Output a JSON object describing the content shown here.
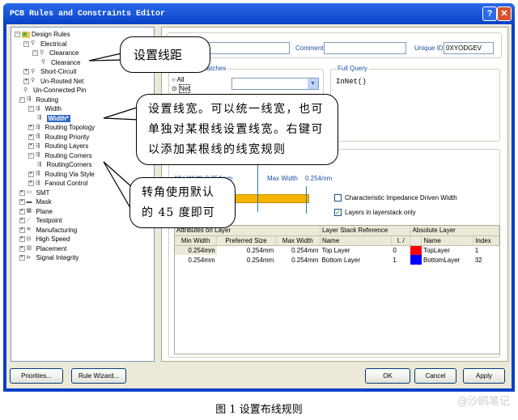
{
  "window": {
    "title": "PCB Rules and Constraints Editor",
    "help": "?",
    "close": "✕"
  },
  "tree": [
    {
      "label": "Design Rules",
      "indent": 0,
      "pm": "−",
      "icon": "folder-icon"
    },
    {
      "label": "Electrical",
      "indent": 1,
      "pm": "−",
      "icon": "electrical-icon"
    },
    {
      "label": "Clearance",
      "indent": 2,
      "pm": "−",
      "icon": "electrical-icon"
    },
    {
      "label": "Clearance",
      "indent": 3,
      "pm": "",
      "icon": "electrical-icon"
    },
    {
      "label": "Short-Circuit",
      "indent": 1,
      "pm": "+",
      "icon": "electrical-icon"
    },
    {
      "label": "Un-Routed Net",
      "indent": 1,
      "pm": "+",
      "icon": "electrical-icon"
    },
    {
      "label": "Un-Connected Pin",
      "indent": 1,
      "pm": "",
      "icon": "electrical-icon"
    },
    {
      "label": "Routing",
      "indent": 0.5,
      "pm": "−",
      "icon": "routing-icon"
    },
    {
      "label": "Width",
      "indent": 1.5,
      "pm": "−",
      "icon": "routing-icon"
    },
    {
      "label": "Width*",
      "indent": 2.5,
      "pm": "",
      "icon": "routing-icon",
      "selected": true
    },
    {
      "label": "Routing Topology",
      "indent": 1.5,
      "pm": "+",
      "icon": "routing-icon"
    },
    {
      "label": "Routing Priority",
      "indent": 1.5,
      "pm": "+",
      "icon": "routing-icon"
    },
    {
      "label": "Routing Layers",
      "indent": 1.5,
      "pm": "+",
      "icon": "routing-icon"
    },
    {
      "label": "Routing Corners",
      "indent": 1.5,
      "pm": "−",
      "icon": "routing-icon"
    },
    {
      "label": "RoutingCorners",
      "indent": 2.5,
      "pm": "",
      "icon": "routing-icon"
    },
    {
      "label": "Routing Via Style",
      "indent": 1.5,
      "pm": "+",
      "icon": "routing-icon"
    },
    {
      "label": "Fanout Control",
      "indent": 1.5,
      "pm": "+",
      "icon": "routing-icon"
    },
    {
      "label": "SMT",
      "indent": 0.5,
      "pm": "+",
      "icon": "smt-icon"
    },
    {
      "label": "Mask",
      "indent": 0.5,
      "pm": "+",
      "icon": "mask-icon"
    },
    {
      "label": "Plane",
      "indent": 0.5,
      "pm": "+",
      "icon": "plane-icon"
    },
    {
      "label": "Testpoint",
      "indent": 0.5,
      "pm": "+",
      "icon": "testpoint-icon"
    },
    {
      "label": "Manufacturing",
      "indent": 0.5,
      "pm": "+",
      "icon": "manufacturing-icon"
    },
    {
      "label": "High Speed",
      "indent": 0.5,
      "pm": "+",
      "icon": "high-speed-icon"
    },
    {
      "label": "Placement",
      "indent": 0.5,
      "pm": "+",
      "icon": "placement-icon"
    },
    {
      "label": "Signal Integrity",
      "indent": 0.5,
      "pm": "+",
      "icon": "signal-integrity-icon"
    }
  ],
  "rule": {
    "name_value": "h",
    "comment_label": "Comment",
    "comment_value": "",
    "uid_label": "Unique ID",
    "uid_value": "0XYODGEV"
  },
  "scope": {
    "title": "st object matches",
    "all": "All",
    "net": "Net",
    "full_query_title": "Full Query",
    "query": "InNet()"
  },
  "constraints": {
    "min_width": "Min Width  0.254mm",
    "max_width_label": "Max Width",
    "max_width_value": "0.254mm",
    "cb1": "Characteristic Impedance Driven Width",
    "cb1_checked": false,
    "cb2": "Layers in layerstack only",
    "cb2_checked": true
  },
  "table": {
    "groups": [
      "Attributes on Layer",
      "Layer Stack Reference",
      "Absolute Layer"
    ],
    "headers": [
      "Min Width",
      "Preferred Size",
      "Max Width",
      "Name",
      "I. /",
      "",
      "Name",
      "Index"
    ],
    "rows": [
      {
        "min": "0.254mm",
        "pref": "0.254mm",
        "max": "0.254mm",
        "name": "Top Layer",
        "i": "0",
        "color": "#ff0000",
        "abs": "TopLayer",
        "index": "1"
      },
      {
        "min": "0.254mm",
        "pref": "0.254mm",
        "max": "0.254mm",
        "name": "Bottom Layer",
        "i": "1",
        "color": "#0000ff",
        "abs": "BottomLayer",
        "index": "32"
      }
    ]
  },
  "buttons": {
    "priorities": "Priorities...",
    "wizard": "Rule Wizard...",
    "ok": "OK",
    "cancel": "Cancel",
    "apply": "Apply"
  },
  "callouts": {
    "c1": "设置线距",
    "c2": "设置线宽。可以统一线宽，也可单独对某根线设置线宽。右键可以添加某根线的线宽规则",
    "c3": "转角使用默认的 45 度即可"
  },
  "caption": "图 1 设置布线规则",
  "watermark": "@沙鸥笔记"
}
